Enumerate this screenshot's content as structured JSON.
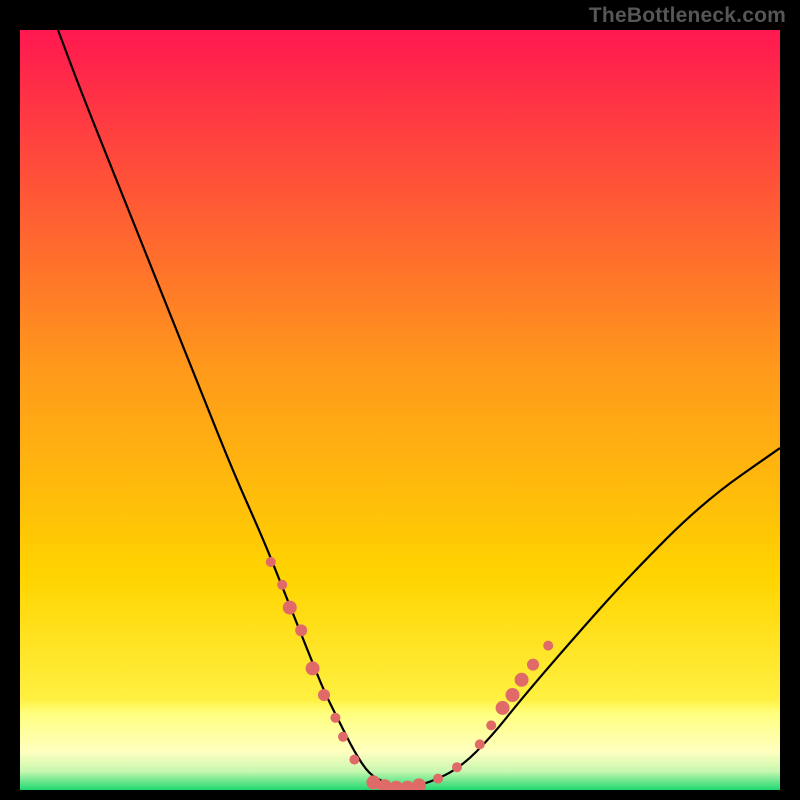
{
  "watermark": "TheBottleneck.com",
  "chart_data": {
    "type": "line",
    "title": "",
    "xlabel": "",
    "ylabel": "",
    "xlim": [
      0,
      100
    ],
    "ylim": [
      0,
      100
    ],
    "grid": false,
    "legend": false,
    "annotations": [],
    "background_gradient": {
      "top": "#ff1850",
      "mid": "#ffd400",
      "bottom_band": "#ffff80",
      "bottom_edge": "#20d870"
    },
    "series": [
      {
        "name": "curve",
        "color": "#000000",
        "x": [
          5,
          8,
          12,
          16,
          20,
          24,
          28,
          32,
          34,
          36,
          38,
          40,
          42,
          44,
          46,
          48,
          50,
          54,
          58,
          62,
          66,
          72,
          80,
          90,
          100
        ],
        "y": [
          100,
          92,
          82,
          72,
          62,
          52,
          42,
          33,
          28,
          23,
          18,
          13,
          9,
          5,
          2,
          1,
          0,
          1,
          3,
          7,
          12,
          19,
          28,
          38,
          45
        ]
      }
    ],
    "points": {
      "name": "markers",
      "color": "#e06a67",
      "radius_small": 5,
      "radius_large": 8,
      "data": [
        {
          "x": 33.0,
          "y": 30.0,
          "r": 5
        },
        {
          "x": 34.5,
          "y": 27.0,
          "r": 5
        },
        {
          "x": 35.5,
          "y": 24.0,
          "r": 7
        },
        {
          "x": 37.0,
          "y": 21.0,
          "r": 6
        },
        {
          "x": 38.5,
          "y": 16.0,
          "r": 7
        },
        {
          "x": 40.0,
          "y": 12.5,
          "r": 6
        },
        {
          "x": 41.5,
          "y": 9.5,
          "r": 5
        },
        {
          "x": 42.5,
          "y": 7.0,
          "r": 5
        },
        {
          "x": 44.0,
          "y": 4.0,
          "r": 5
        },
        {
          "x": 46.5,
          "y": 1.0,
          "r": 7
        },
        {
          "x": 48.0,
          "y": 0.5,
          "r": 7
        },
        {
          "x": 49.5,
          "y": 0.3,
          "r": 7
        },
        {
          "x": 51.0,
          "y": 0.3,
          "r": 7
        },
        {
          "x": 52.5,
          "y": 0.6,
          "r": 7
        },
        {
          "x": 55.0,
          "y": 1.5,
          "r": 5
        },
        {
          "x": 57.5,
          "y": 3.0,
          "r": 5
        },
        {
          "x": 60.5,
          "y": 6.0,
          "r": 5
        },
        {
          "x": 62.0,
          "y": 8.5,
          "r": 5
        },
        {
          "x": 63.5,
          "y": 10.8,
          "r": 7
        },
        {
          "x": 64.8,
          "y": 12.5,
          "r": 7
        },
        {
          "x": 66.0,
          "y": 14.5,
          "r": 7
        },
        {
          "x": 67.5,
          "y": 16.5,
          "r": 6
        },
        {
          "x": 69.5,
          "y": 19.0,
          "r": 5
        }
      ]
    }
  }
}
